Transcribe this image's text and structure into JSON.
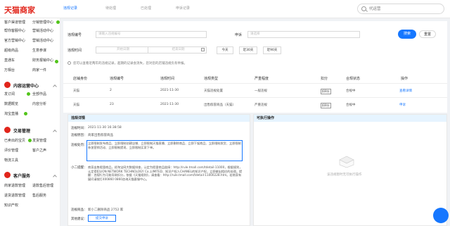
{
  "header": {
    "logo": "天猫商家",
    "search_placeholder": "代运营",
    "tabs": [
      "违规记录",
      "待处理",
      "已处理",
      "申诉记录"
    ]
  },
  "sidebar": {
    "top_items": [
      [
        "客户渠道管理",
        "分销管理中心"
      ],
      [
        "帮你客服中心",
        "营销活动中心"
      ],
      [
        "官方营销中心",
        "营销活动中心"
      ],
      [
        "超级商品",
        "生意参谋"
      ],
      [
        "直通车",
        "财务报销中心"
      ],
      [
        "万相台",
        "商家一件"
      ]
    ],
    "groups": [
      {
        "title": "内容运营中心",
        "items": [
          [
            "发订阅",
            "全部作品"
          ],
          [
            "数据概览",
            "内容分析"
          ],
          [
            "淘宝直播",
            ""
          ]
        ]
      },
      {
        "title": "交易管理",
        "items": [
          [
            "已卖出的宝贝",
            "发货管理"
          ],
          [
            "评价管理",
            "客户之声"
          ],
          [
            "物流工具",
            ""
          ]
        ]
      },
      {
        "title": "客户服务",
        "items": [
          [
            "商家退款管理",
            "退款售后管理"
          ],
          [
            "退货退款管理",
            "售后服务"
          ],
          [
            "知识产权",
            ""
          ]
        ]
      }
    ],
    "colors": {
      "brand": "#e1251b",
      "badge": "#52c41a"
    }
  },
  "filters": {
    "violation_id_label": "违规编号",
    "violation_id_placeholder": "请输入违规编号",
    "appeal_label": "申诉",
    "appeal_placeholder": "请选择",
    "time_label": "违规时间",
    "start_placeholder": "开始日期",
    "end_placeholder": "结束日期",
    "quick_ranges": [
      "今天",
      "近30天",
      "近90天"
    ],
    "search_label": "搜索",
    "reset_label": "重置",
    "tip": "您可以查看近两年的违规记录，超期的记录会消失，您对您的店铺违规负有举报。"
  },
  "table": {
    "headers": [
      "店铺身份",
      "违规编号",
      "违规时间",
      "违规类型",
      "严重程度",
      "扣分",
      "合规状态",
      "操作"
    ],
    "rows": [
      {
        "shop": "天猫",
        "id": "2",
        "time": "2021-11-30",
        "type": "天猫违规处置",
        "severity": "一般违规",
        "points": "扣0分",
        "status": "合规中",
        "action": "查看详情"
      },
      {
        "shop": "天猫",
        "id": "23",
        "time": "2021-11-30",
        "type": "出售假冒商品（天猫）",
        "severity": "严重违规",
        "points": "扣0分",
        "status": "合规中",
        "action": "申诉"
      }
    ],
    "colors": {
      "link": "#1677ff"
    }
  },
  "detail": {
    "title": "违规详情",
    "time_label": "违规时间：",
    "time_value": "2021-11-30 16:38:58",
    "reason_label": "违规原因：",
    "reason_value": "商家出售假冒商品",
    "penalty_label": "违规处罚：",
    "penalty_value": "立即限制发布商品、立即限制创建店铺、立即限制天猫直播、立即删除商品、立即下架商品、立即限制发货、立即限制参加营销活动、立即限制提现、立即限制买家下单。",
    "note_label": "小二提醒：",
    "note_value": "商家出售假冒商品，经淘宝网大数据排查，认定为假冒商品链接：http://rule.tmall.com/tdetail-11000，根据规则，认定侵犯LION NETWORK TECHNOLOGY Co.,LIMITED、知识产权人CHANEL的知识产权，立即做出相应的处理。提醒：违规行为可能导致扣分，依据《天猫规则》，请查看：http://rule.tmall.com/tdetail-11000228.htm。若商家有疑问请拨打400860 0860咨询天猫客服中心。",
    "product_label": "违规商品：",
    "product_value": "新小二删除商品 2752 家",
    "other_label": "其他建议：",
    "appeal_btn": "提交申诉"
  },
  "ops": {
    "title": "可执行操作",
    "empty_text": "该违规暂时无可执行操作"
  }
}
